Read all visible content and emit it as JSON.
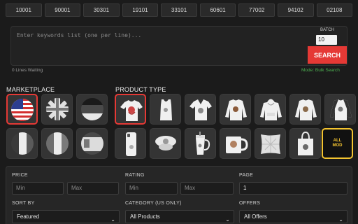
{
  "zip_codes": [
    "10001",
    "90001",
    "30301",
    "19101",
    "33101",
    "60601",
    "77002",
    "94102",
    "02108"
  ],
  "keywords": {
    "placeholder": "Enter keywords list (one per line)...",
    "lines_waiting": "0 Lines Waiting",
    "mode": "Mode: Bulk Search"
  },
  "batch": {
    "label": "BATCH",
    "value": "10"
  },
  "search_button": "SEARCH",
  "marketplace": {
    "title": "MARKETPLACE",
    "flags": [
      "US",
      "UK",
      "DE",
      "FR",
      "IT",
      "ES"
    ],
    "selected": "US"
  },
  "product_type": {
    "title": "PRODUCT TYPE",
    "items": [
      "T-Shirt",
      "Tank Top",
      "V-Neck",
      "Sweatshirt",
      "Hoodie",
      "Long Sleeve",
      "Raglan",
      "Phone Case",
      "PopSocket",
      "Tumbler",
      "Mug",
      "Throw Pillow",
      "Tote Bag",
      "All MOD"
    ],
    "selected": "T-Shirt",
    "all_mod_label_1": "ALL",
    "all_mod_label_2": "MOD"
  },
  "filters": {
    "price_label": "PRICE",
    "rating_label": "RATING",
    "page_label": "PAGE",
    "min_placeholder": "Min",
    "max_placeholder": "Max",
    "page_value": "1",
    "sort_label": "SORT BY",
    "sort_value": "Featured",
    "category_label": "CATEGORY (US ONLY)",
    "category_value": "All Products",
    "offers_label": "OFFERS",
    "offers_value": "All Offers"
  },
  "colors": {
    "accent_red": "#e53935",
    "accent_yellow": "#f4c430",
    "mode_green": "#4caf50"
  }
}
